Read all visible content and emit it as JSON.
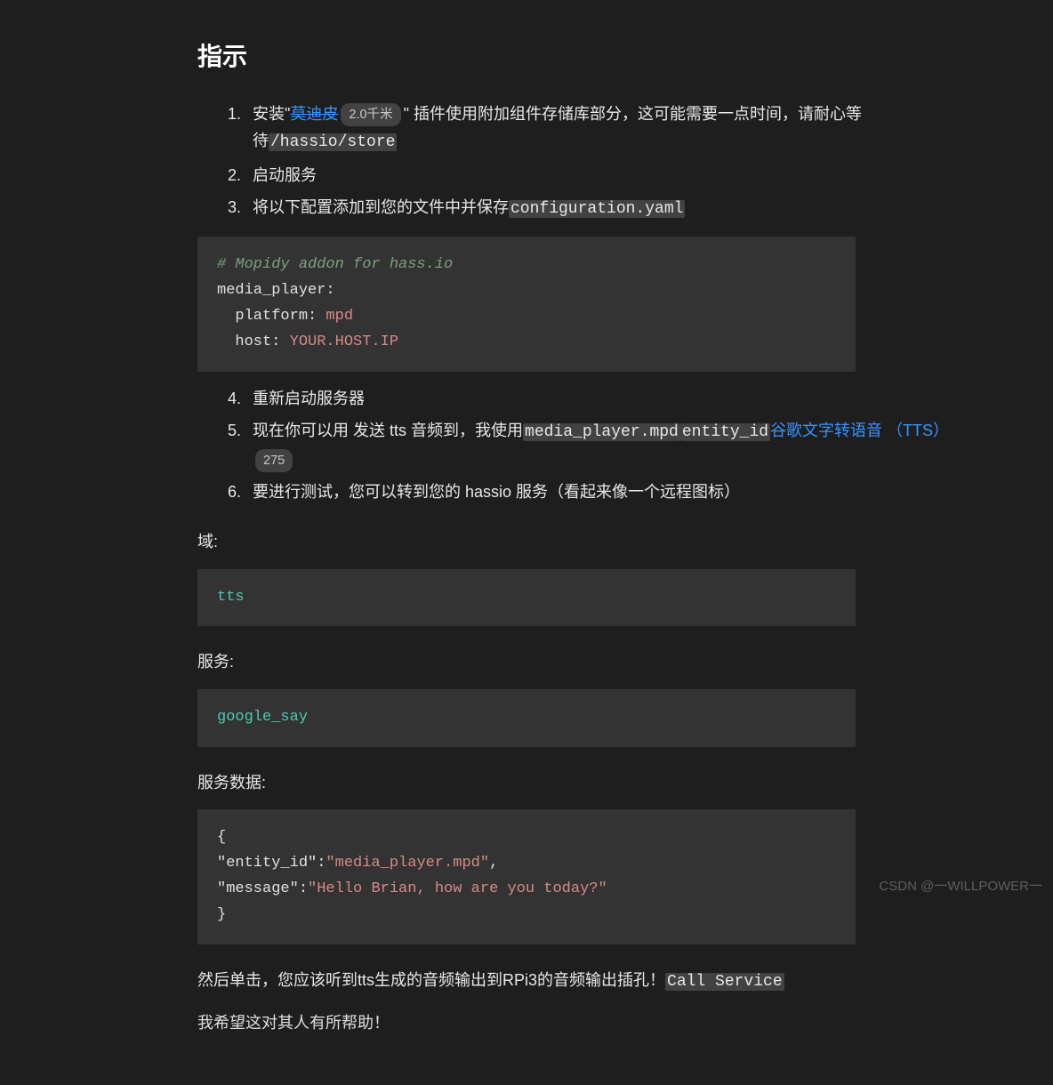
{
  "heading": "指示",
  "list1": {
    "item1": {
      "prefix": "安装\"",
      "link_text": "莫迪皮",
      "badge": "2.0千米",
      "suffix1": "\" 插件使用附加组件存储库部分，这可能需要一点时间，请耐心等待",
      "code": "/hassio/store"
    },
    "item2": "启动服务",
    "item3": {
      "text": "将以下配置添加到您的文件中并保存",
      "code": "configuration.yaml"
    }
  },
  "code1": {
    "comment": "# Mopidy addon for hass.io",
    "line2": "media_player:",
    "line3_key": "  platform:",
    "line3_val": " mpd",
    "line4_key": "  host:",
    "line4_val": " YOUR.HOST.IP"
  },
  "list2": {
    "item4": "重新启动服务器",
    "item5": {
      "prefix": "现在你可以用 发送 tts 音频到，我使用",
      "code1": "media_player.mpd",
      "code2": "entity_id",
      "link": "谷歌文字转语音 （TTS）",
      "badge": "275"
    },
    "item6": "要进行测试，您可以转到您的 hassio 服务（看起来像一个远程图标）"
  },
  "labels": {
    "domain": "域:",
    "service": "服务:",
    "servicedata": "服务数据:"
  },
  "code2": "tts",
  "code3": "google_say",
  "code4": {
    "l1": "{",
    "l2a": "\"entity_id\"",
    "l2b": ":",
    "l2c": "\"media_player.mpd\"",
    "l2d": ",",
    "l3a": "\"message\"",
    "l3b": ":",
    "l3c": "\"Hello Brian, how are you today?\"",
    "l4": "}"
  },
  "bottom": {
    "prefix": "然后单击，您应该听到tts生成的音频输出到RPi3的音频输出插孔！",
    "code": "Call Service"
  },
  "cutoff": "我希望这对其人有所帮助！",
  "watermark": "CSDN @一WILLPOWER一"
}
